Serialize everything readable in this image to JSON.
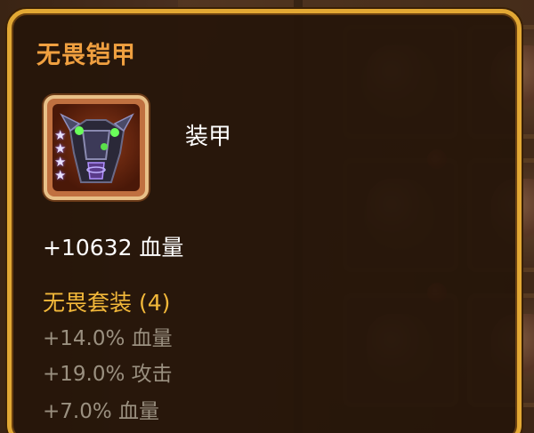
{
  "tooltip": {
    "title": "无畏铠甲",
    "item_type": "装甲",
    "item_stars": 4,
    "main_stat": "+10632 血量",
    "set_title": "无畏套装 (4)",
    "set_bonuses": [
      "+14.0% 血量",
      "+19.0% 攻击",
      "+7.0% 血量"
    ]
  },
  "icons": {
    "item": "armor-icon",
    "star": "star-icon"
  },
  "colors": {
    "title": "#f0a040",
    "border": "#e2a834",
    "set_title": "#f2b83a",
    "inactive_bonus": "#9a9080",
    "stat_text": "#ffffff"
  }
}
